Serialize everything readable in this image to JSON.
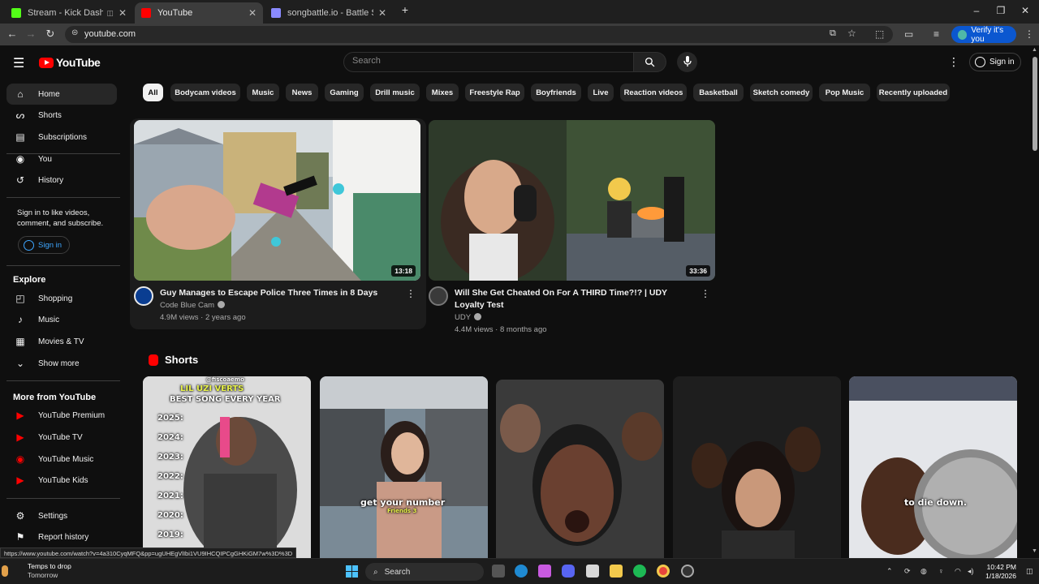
{
  "browser": {
    "tabs": [
      {
        "title": "Stream - Kick Dashboard",
        "favicon_color": "#53fc18"
      },
      {
        "title": "YouTube",
        "favicon_color": "#ff0000"
      },
      {
        "title": "songbattle.io - Battle Songs ag",
        "favicon_color": "#8a8aff"
      }
    ],
    "url": "youtube.com",
    "verify_label": "Verify it's you",
    "status_url": "https://www.youtube.com/watch?v=4a310CyqMFQ&pp=ugUHEgVlIbi1VU9IHCQIPCgGHKiGM7w%3D%3D"
  },
  "header": {
    "logo_text": "YouTube",
    "search_placeholder": "Search",
    "sign_in": "Sign in"
  },
  "sidebar": {
    "main": [
      {
        "label": "Home",
        "icon": "home-icon"
      },
      {
        "label": "Shorts",
        "icon": "shorts-icon"
      },
      {
        "label": "Subscriptions",
        "icon": "subscriptions-icon"
      }
    ],
    "you": [
      {
        "label": "You",
        "icon": "you-icon"
      },
      {
        "label": "History",
        "icon": "history-icon"
      }
    ],
    "signin_message": "Sign in to like videos, comment, and subscribe.",
    "signin_button": "Sign in",
    "explore_heading": "Explore",
    "explore": [
      {
        "label": "Shopping",
        "icon": "shopping-icon"
      },
      {
        "label": "Music",
        "icon": "music-icon"
      },
      {
        "label": "Movies & TV",
        "icon": "movies-icon"
      },
      {
        "label": "Show more",
        "icon": "chevron-down-icon"
      }
    ],
    "more_heading": "More from YouTube",
    "more": [
      {
        "label": "YouTube Premium",
        "icon": "yt-premium-icon"
      },
      {
        "label": "YouTube TV",
        "icon": "yt-tv-icon"
      },
      {
        "label": "YouTube Music",
        "icon": "yt-music-icon"
      },
      {
        "label": "YouTube Kids",
        "icon": "yt-kids-icon"
      }
    ],
    "settings": [
      {
        "label": "Settings",
        "icon": "gear-icon"
      },
      {
        "label": "Report history",
        "icon": "flag-icon"
      }
    ]
  },
  "chips": [
    "All",
    "Bodycam videos",
    "Music",
    "News",
    "Gaming",
    "Drill music",
    "Mixes",
    "Freestyle Rap",
    "Boyfriends",
    "Live",
    "Reaction videos",
    "Basketball",
    "Sketch comedy",
    "Pop Music",
    "Recently uploaded"
  ],
  "videos": [
    {
      "title": "Guy Manages to Escape Police Three Times in 8 Days",
      "channel": "Code Blue Cam",
      "meta": "4.9M views · 2 years ago",
      "duration": "13:18"
    },
    {
      "title": "Will She Get Cheated On For A THIRD Time?!? | UDY Loyalty Test",
      "channel": "UDY",
      "meta": "4.4M views · 8 months ago",
      "duration": "33:36"
    }
  ],
  "shorts": {
    "heading": "Shorts",
    "items": [
      {
        "handle": "@fiscoaemo",
        "caption_top": "LIL UZI VERTS",
        "caption_bottom": "BEST SONG EVERY YEAR",
        "years": [
          "2025:",
          "2024:",
          "2023:",
          "2022:",
          "2021:",
          "2020:",
          "2019:"
        ]
      },
      {
        "caption": "get your number",
        "sub_caption": "Friends 3"
      },
      {},
      {},
      {
        "caption": "to die down."
      }
    ]
  },
  "taskbar": {
    "weather_title": "Temps to drop",
    "weather_sub": "Tomorrow",
    "search_label": "Search",
    "time": "10:42 PM",
    "date": "1/18/2026"
  }
}
